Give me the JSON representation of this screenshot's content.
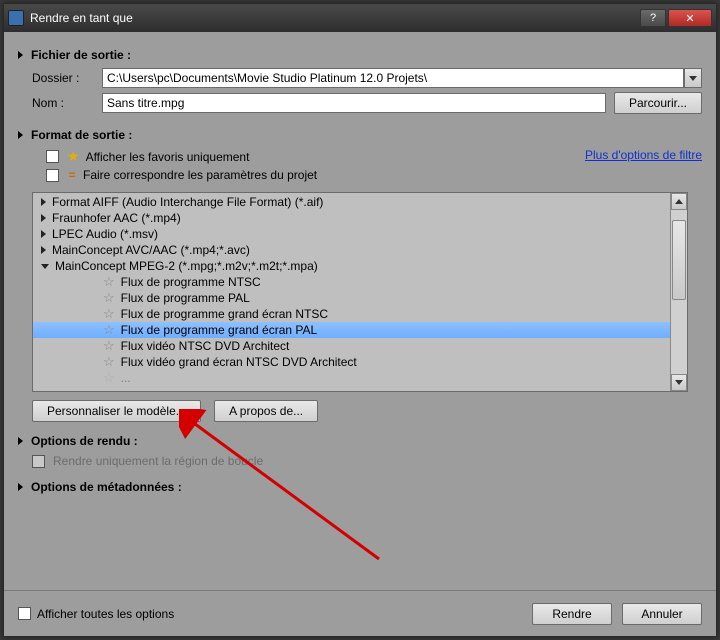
{
  "window": {
    "title": "Rendre en tant que"
  },
  "sections": {
    "output_file": {
      "title": "Fichier de sortie :",
      "folder_label": "Dossier :",
      "folder_value": "C:\\Users\\pc\\Documents\\Movie Studio Platinum 12.0 Projets\\",
      "name_label": "Nom :",
      "name_value": "Sans titre.mpg",
      "browse_button": "Parcourir..."
    },
    "output_format": {
      "title": "Format de sortie :",
      "show_favorites_label": "Afficher les favoris uniquement",
      "match_project_label": "Faire correspondre les paramètres du projet",
      "filter_link": "Plus d'options de filtre",
      "formats": [
        {
          "label": "Format AIFF (Audio Interchange File Format) (*.aif)",
          "expanded": false
        },
        {
          "label": "Fraunhofer AAC (*.mp4)",
          "expanded": false
        },
        {
          "label": "LPEC Audio (*.msv)",
          "expanded": false
        },
        {
          "label": "MainConcept AVC/AAC (*.mp4;*.avc)",
          "expanded": false
        },
        {
          "label": "MainConcept MPEG-2 (*.mpg;*.m2v;*.m2t;*.mpa)",
          "expanded": true,
          "children": [
            {
              "label": "Flux de programme NTSC",
              "selected": false
            },
            {
              "label": "Flux de programme PAL",
              "selected": false
            },
            {
              "label": "Flux de programme grand écran NTSC",
              "selected": false
            },
            {
              "label": "Flux de programme grand écran PAL",
              "selected": true
            },
            {
              "label": "Flux vidéo NTSC DVD Architect",
              "selected": false
            },
            {
              "label": "Flux vidéo grand écran NTSC DVD Architect",
              "selected": false
            }
          ]
        }
      ],
      "customize_button": "Personnaliser le modèle...",
      "about_button": "A propos de..."
    },
    "render_options": {
      "title": "Options de rendu :",
      "loop_region_label": "Rendre uniquement la région de boucle"
    },
    "metadata_options": {
      "title": "Options de métadonnées :"
    }
  },
  "footer": {
    "show_all_label": "Afficher toutes les options",
    "render_button": "Rendre",
    "cancel_button": "Annuler"
  }
}
